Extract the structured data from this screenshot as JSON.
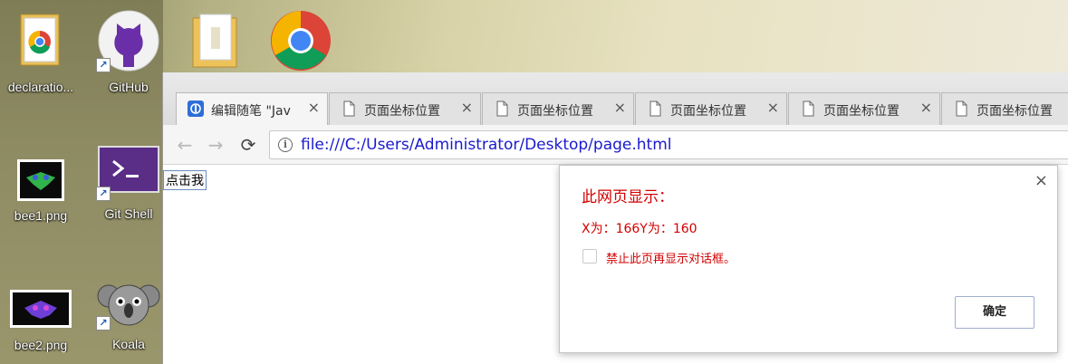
{
  "desktop": {
    "icons": [
      {
        "name": "declaration-file-icon",
        "label": "declaratio..."
      },
      {
        "name": "github-icon",
        "label": "GitHub"
      },
      {
        "name": "folder-icon",
        "label": ""
      },
      {
        "name": "chrome-icon",
        "label": ""
      },
      {
        "name": "bee1-image-icon",
        "label": "bee1.png"
      },
      {
        "name": "git-shell-icon",
        "label": "Git Shell"
      },
      {
        "name": "bee2-image-icon",
        "label": "bee2.png"
      },
      {
        "name": "koala-icon",
        "label": "Koala"
      }
    ]
  },
  "browser": {
    "tabs": [
      {
        "title": "编辑随笔 \"Jav",
        "close": "×",
        "icon": "cnblogs-icon"
      },
      {
        "title": "页面坐标位置",
        "close": "×",
        "icon": "page-icon"
      },
      {
        "title": "页面坐标位置",
        "close": "×",
        "icon": "page-icon"
      },
      {
        "title": "页面坐标位置",
        "close": "×",
        "icon": "page-icon"
      },
      {
        "title": "页面坐标位置",
        "close": "×",
        "icon": "page-icon"
      },
      {
        "title": "页面坐标位置",
        "close": "",
        "icon": "page-icon"
      }
    ],
    "toolbar": {
      "back": "←",
      "forward": "→",
      "reload": "⟳",
      "info_icon": "i",
      "url": "file:///C:/Users/Administrator/Desktop/page.html"
    },
    "page": {
      "button_label": "点击我"
    }
  },
  "dialog": {
    "title": "此网页显示：",
    "message": "X为：166Y为：160",
    "checkbox_label": "禁止此页再显示对话框。",
    "ok_label": "确定",
    "close": "×"
  },
  "colors": {
    "dialog_text": "#d40000",
    "url": "#1a1acd"
  }
}
